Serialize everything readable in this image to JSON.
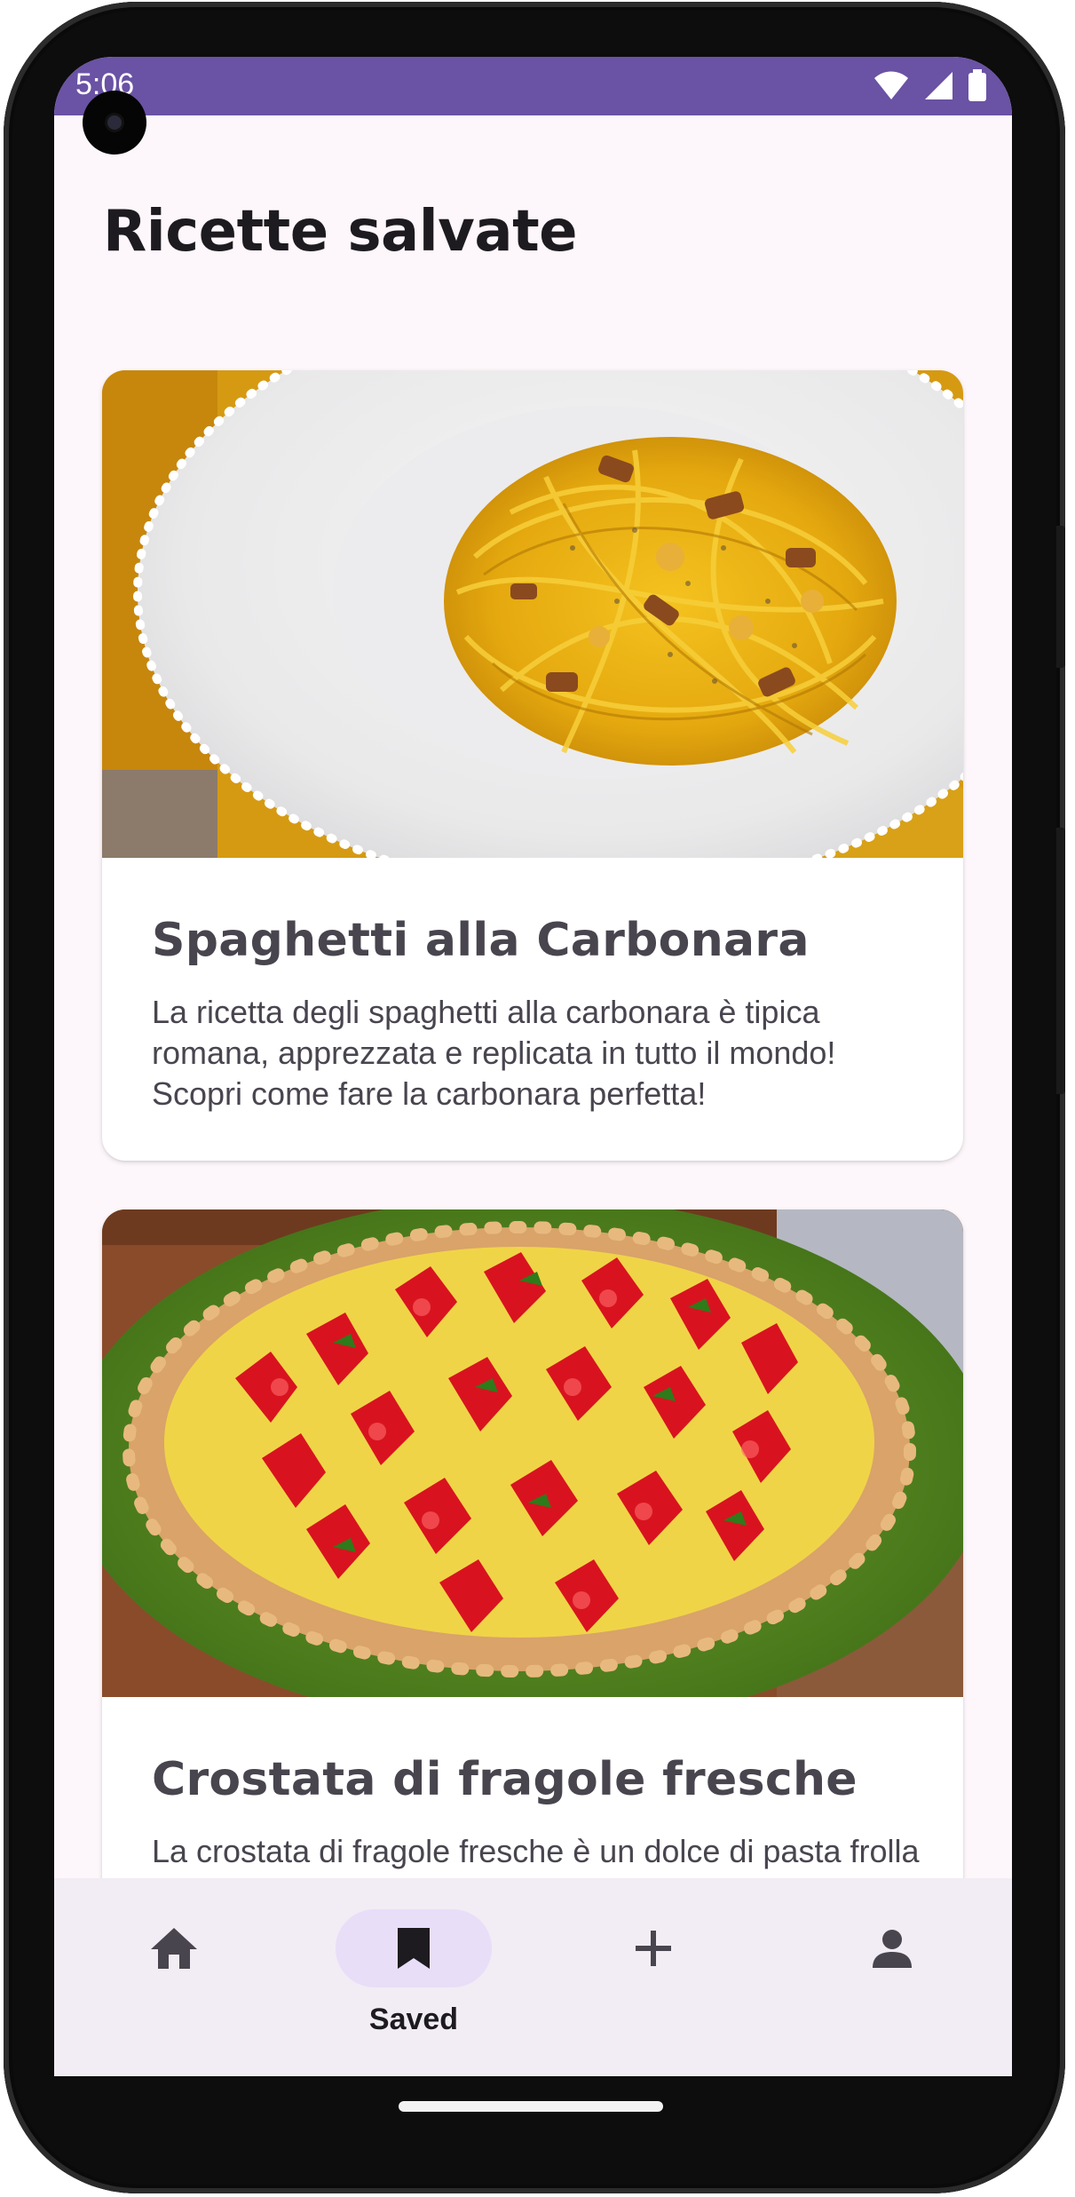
{
  "status_bar": {
    "time": "5:06",
    "background": "#6a52a4",
    "icons": [
      "wifi-icon",
      "signal-icon",
      "battery-icon"
    ]
  },
  "page": {
    "title": "Ricette salvate",
    "background": "#fdf7fb"
  },
  "recipes": [
    {
      "title": "Spaghetti alla Carbonara",
      "description": "La ricetta degli spaghetti alla carbonara è tipica romana, apprezzata e replicata in tutto il mondo! Scopri come fare la carbonara perfetta!",
      "image": "carbonara-photo"
    },
    {
      "title": "Crostata di fragole fresche",
      "description": "La crostata di fragole fresche è un dolce di pasta frolla con crema pasticcera e fragole perfette",
      "image": "strawberry-tart-photo"
    }
  ],
  "bottom_nav": {
    "items": [
      {
        "icon": "home-icon",
        "label": ""
      },
      {
        "icon": "bookmark-icon",
        "label": "Saved",
        "active": true
      },
      {
        "icon": "add-icon",
        "label": ""
      },
      {
        "icon": "person-icon",
        "label": ""
      }
    ],
    "active_indicator_color": "#e8def8"
  }
}
